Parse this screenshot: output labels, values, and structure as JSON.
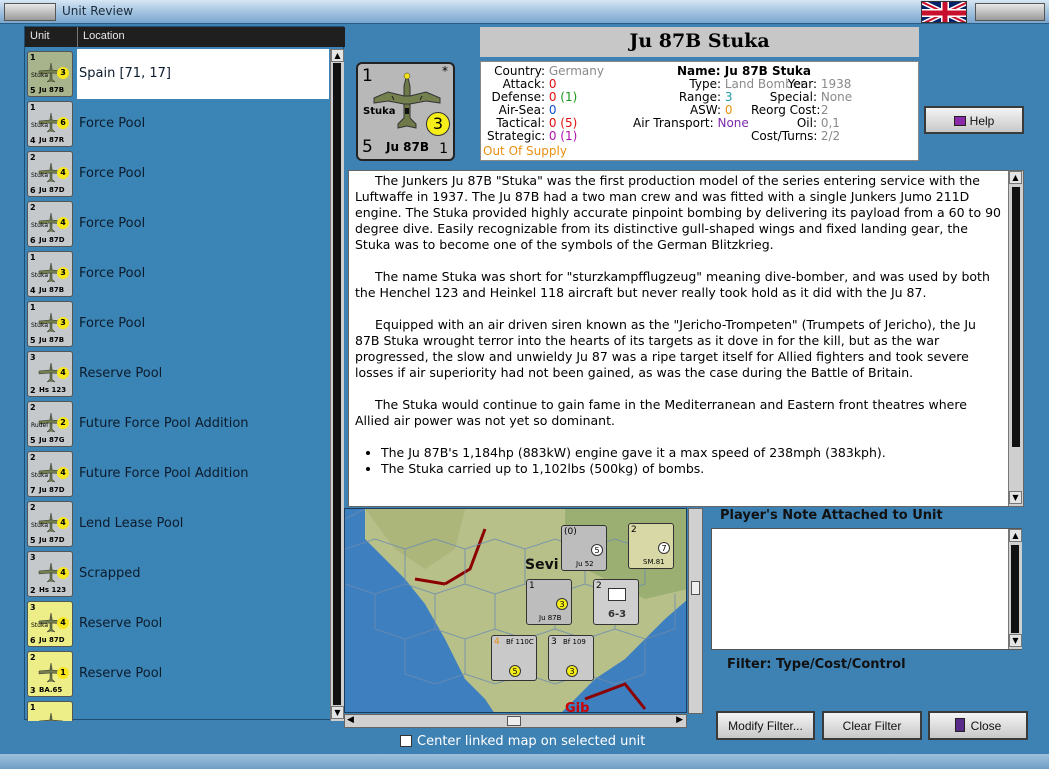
{
  "window": {
    "title": "Unit Review"
  },
  "list": {
    "headers": {
      "unit": "Unit",
      "location": "Location"
    },
    "rows": [
      {
        "location": "Spain [71, 17]",
        "top": "1",
        "mid": "3",
        "bottom": "5",
        "name": "Ju 87B",
        "label": "Stuka",
        "color": "#a8b48c",
        "selected": true
      },
      {
        "location": "Force Pool",
        "top": "1",
        "mid": "6",
        "bottom": "4",
        "name": "Ju 87R",
        "label": "Stuka",
        "color": "#c6c9cc",
        "selected": false
      },
      {
        "location": "Force Pool",
        "top": "2",
        "mid": "4",
        "bottom": "6",
        "name": "Ju 87D",
        "label": "Stuka",
        "color": "#c6c9cc",
        "selected": false
      },
      {
        "location": "Force Pool",
        "top": "2",
        "mid": "4",
        "bottom": "6",
        "name": "Ju 87D",
        "label": "Stuka",
        "color": "#c6c9cc",
        "selected": false
      },
      {
        "location": "Force Pool",
        "top": "1",
        "mid": "3",
        "bottom": "4",
        "name": "Ju 87B",
        "label": "Stuka",
        "color": "#c6c9cc",
        "selected": false
      },
      {
        "location": "Force Pool",
        "top": "1",
        "mid": "3",
        "bottom": "5",
        "name": "Ju 87B",
        "label": "Stuka",
        "color": "#c6c9cc",
        "selected": false
      },
      {
        "location": "Reserve Pool",
        "top": "3",
        "mid": "4",
        "bottom": "2",
        "name": "Hs 123",
        "label": "",
        "color": "#c6c9cc",
        "selected": false
      },
      {
        "location": "Future Force Pool Addition",
        "top": "2",
        "mid": "2",
        "bottom": "5",
        "name": "Ju 87G",
        "label": "Rudel",
        "color": "#c6c9cc",
        "selected": false
      },
      {
        "location": "Future Force Pool Addition",
        "top": "2",
        "mid": "4",
        "bottom": "7",
        "name": "Ju 87D",
        "label": "Stuka",
        "color": "#c6c9cc",
        "selected": false
      },
      {
        "location": "Lend Lease Pool",
        "top": "2",
        "mid": "4",
        "bottom": "5",
        "name": "Ju 87D",
        "label": "Stuka",
        "color": "#c6c9cc",
        "selected": false
      },
      {
        "location": "Scrapped",
        "top": "3",
        "mid": "4",
        "bottom": "2",
        "name": "Hs 123",
        "label": "",
        "color": "#c6c9cc",
        "selected": false
      },
      {
        "location": "Reserve Pool",
        "top": "3",
        "mid": "4",
        "bottom": "6",
        "name": "Ju 87D",
        "label": "Stuka",
        "color": "#eeee88",
        "selected": false
      },
      {
        "location": "Reserve Pool",
        "top": "2",
        "mid": "1",
        "bottom": "3",
        "name": "BA.65",
        "label": "",
        "color": "#eeee88",
        "selected": false
      },
      {
        "location": "",
        "top": "1",
        "mid": "",
        "bottom": "",
        "name": "",
        "label": "",
        "color": "#eeee88",
        "selected": false
      }
    ]
  },
  "unit": {
    "title": "Ju 87B Stuka",
    "counter": {
      "top_left": "1",
      "top_right": "*",
      "label": "Stuka",
      "bottom_left": "5",
      "name": "Ju 87B",
      "bottom_right": "1",
      "circle": "3"
    },
    "stats": {
      "country_label": "Country:",
      "country": "Germany",
      "attack_label": "Attack:",
      "attack": "0",
      "defense_label": "Defense:",
      "defense": "0",
      "defense_extra": "(1)",
      "airsea_label": "Air-Sea:",
      "airsea": "0",
      "tactical_label": "Tactical:",
      "tactical": "0",
      "tactical_extra": "(5)",
      "strategic_label": "Strategic:",
      "strategic": "0",
      "strategic_extra": "(1)",
      "supply": "Out Of Supply",
      "name_label": "Name:",
      "name": "Ju 87B Stuka",
      "type_label": "Type:",
      "type": "Land Bomber",
      "year_label": "Year:",
      "year": "1938",
      "range_label": "Range:",
      "range": "3",
      "special_label": "Special:",
      "special": "None",
      "asw_label": "ASW:",
      "asw": "0",
      "reorg_label": "Reorg Cost:",
      "reorg": "2",
      "oil_label": "Oil:",
      "oil": "0,1",
      "airtransport_label": "Air Transport:",
      "airtransport": "None",
      "costturns_label": "Cost/Turns:",
      "costturns": "2/2"
    },
    "description": {
      "p1": "The Junkers Ju 87B \"Stuka\" was the first production model of the series entering service with the Luftwaffe in 1937.  The Ju 87B had a two man crew and was fitted with a single Junkers Jumo 211D engine.  The Stuka provided highly accurate pinpoint bombing by delivering its payload from a 60 to 90 degree dive.  Easily recognizable from its distinctive gull-shaped wings and fixed landing gear, the Stuka was to become one of the symbols of the German Blitzkrieg.",
      "p2": "The name Stuka was short for \"sturzkampfflugzeug\" meaning dive-bomber, and was used by both the Henchel 123 and Heinkel 118 aircraft but never really took hold as it did with the Ju 87.",
      "p3": "Equipped with an air driven siren known as the \"Jericho-Trompeten\" (Trumpets of Jericho), the Ju 87B Stuka wrought terror into the hearts of its targets as it dove in for the kill, but as the war progressed, the slow and unwieldy Ju 87 was a ripe target itself for Allied fighters and took severe losses if air superiority had not been gained, as was the case during the Battle of Britain.",
      "p4": "The Stuka would continue to gain fame in the Mediterranean and Eastern front theatres where Allied air power was not yet so dominant.",
      "bullet1": "The Ju 87B's 1,184hp (883kW) engine gave it a max speed of 238mph (383kph).",
      "bullet2": "The Stuka carried up to 1,102lbs (500kg) of bombs."
    }
  },
  "map": {
    "city1": "Sevi",
    "city2": "Gib",
    "counters": [
      {
        "name": "Ju 52",
        "top": "(0)",
        "val": "5"
      },
      {
        "name": "SM.81",
        "top": "2",
        "val": "7"
      },
      {
        "name": "Ju 87B",
        "top": "1",
        "val": "3"
      },
      {
        "name": "6-3",
        "top": "2",
        "val": ""
      },
      {
        "name": "Bf 110C",
        "top": "4",
        "val": "5"
      },
      {
        "name": "Bf 109",
        "top": "3",
        "val": "3"
      }
    ]
  },
  "buttons": {
    "help": "Help",
    "modify_filter": "Modify Filter...",
    "clear_filter": "Clear Filter",
    "close": "Close"
  },
  "notes": {
    "label": "Player's Note Attached to Unit"
  },
  "filter": {
    "label": "Filter:  Type/Cost/Control"
  },
  "center_map": {
    "label": "Center linked map on selected unit"
  }
}
